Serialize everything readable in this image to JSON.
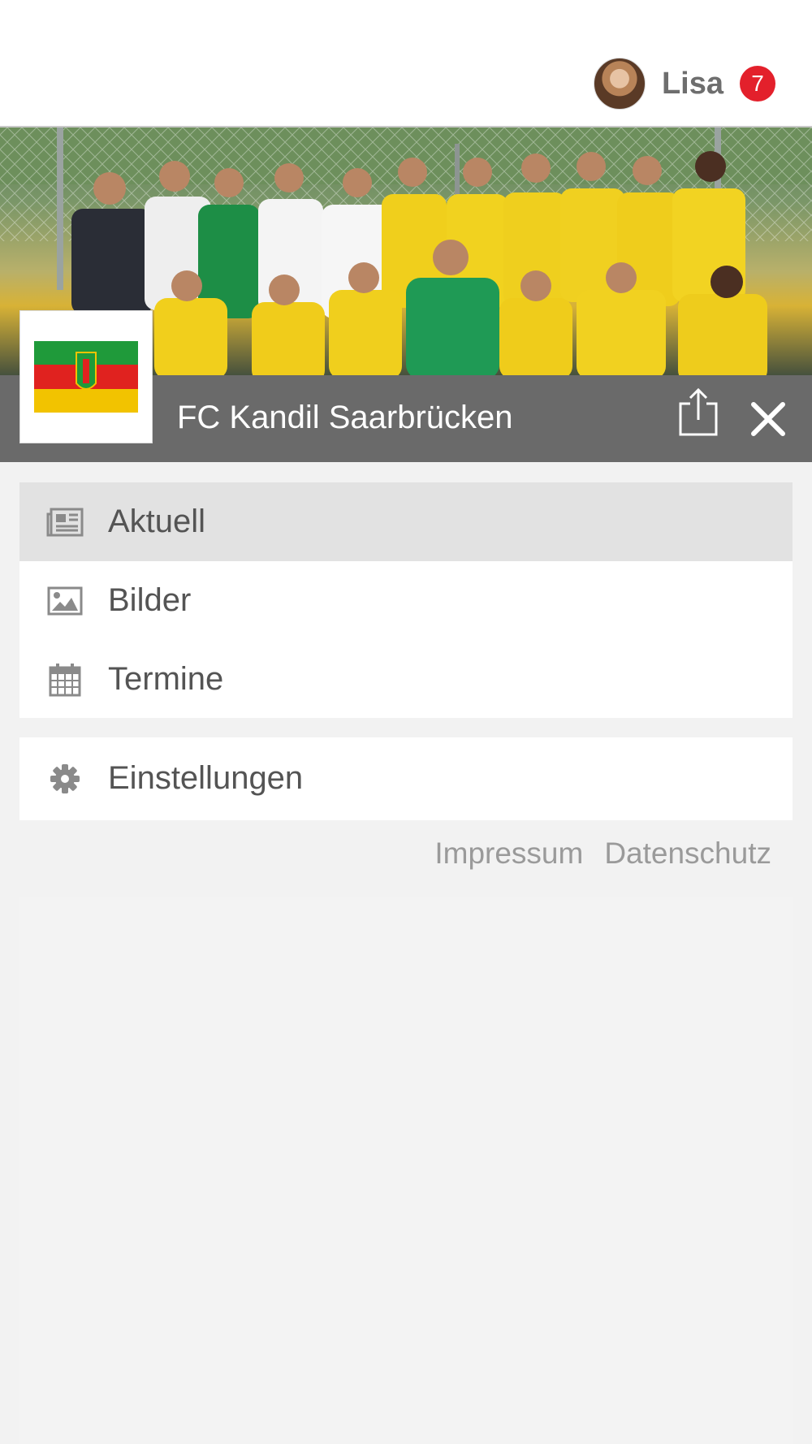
{
  "header": {
    "user_name": "Lisa",
    "notification_count": "7"
  },
  "club": {
    "name": "FC Kandil Saarbrücken",
    "flag_colors": [
      "#1f9a3a",
      "#e0221f",
      "#f2c300"
    ]
  },
  "menu": {
    "items": [
      {
        "label": "Aktuell",
        "icon": "newspaper-icon",
        "active": true
      },
      {
        "label": "Bilder",
        "icon": "image-icon",
        "active": false
      },
      {
        "label": "Termine",
        "icon": "calendar-icon",
        "active": false
      }
    ],
    "settings": {
      "label": "Einstellungen",
      "icon": "gear-icon"
    }
  },
  "footer": {
    "impressum": "Impressum",
    "datenschutz": "Datenschutz"
  },
  "colors": {
    "badge": "#e3202b",
    "club_bar": "#6a6a6a",
    "active_item": "#e2e2e2"
  }
}
